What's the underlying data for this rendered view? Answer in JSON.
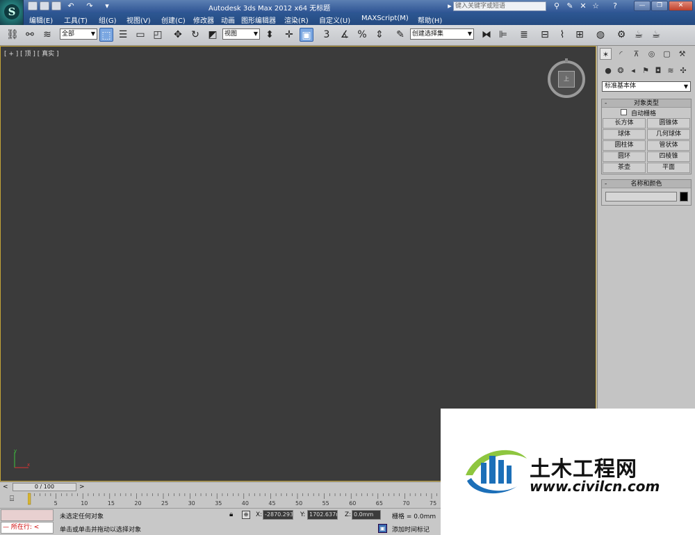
{
  "window": {
    "title": "Autodesk 3ds Max  2012 x64       无标题",
    "search_placeholder": "键入关键字或短语"
  },
  "menu": [
    "编辑(E)",
    "工具(T)",
    "组(G)",
    "视图(V)",
    "创建(C)",
    "修改器",
    "动画",
    "图形编辑器",
    "渲染(R)",
    "自定义(U)",
    "MAXScript(M)",
    "帮助(H)"
  ],
  "toolbar": {
    "selection_filter": "全部",
    "ref_coord": "视图",
    "named_selection": "创建选择集",
    "snap_3": "3",
    "percent_snap": "%"
  },
  "viewport": {
    "label": "[ + ] [ 顶 ] [ 真实 ]",
    "viewcube_face": "上",
    "axis_x": "x",
    "axis_y": "y"
  },
  "command_panel": {
    "category": "标准基本体",
    "object_type": {
      "title": "对象类型",
      "autogrid_label": "自动栅格",
      "autogrid_checked": false,
      "buttons": [
        "长方体",
        "圆锥体",
        "球体",
        "几何球体",
        "圆柱体",
        "管状体",
        "圆环",
        "四棱锥",
        "茶壶",
        "平面"
      ]
    },
    "name_color": {
      "title": "名称和颜色",
      "name_value": "",
      "color": "#000000"
    },
    "rollout_minus": "-"
  },
  "time_slider": {
    "frame_label": "0 / 100",
    "prev": "<",
    "next": ">"
  },
  "track_bar": {
    "ticks": [
      "5",
      "10",
      "15",
      "20",
      "25",
      "30",
      "35",
      "40",
      "45",
      "50",
      "55",
      "60",
      "65",
      "70",
      "75"
    ]
  },
  "status": {
    "running_label": "所在行:",
    "selection": "未选定任何对象",
    "prompt": "单击或单击并拖动以选择对象",
    "x_label": "X:",
    "x_value": "-2870.293",
    "y_label": "Y:",
    "y_value": "1702.637m",
    "z_label": "Z:",
    "z_value": "0.0mm",
    "grid": "栅格 = 0.0mm",
    "add_time_tag": "添加时间标记"
  },
  "watermark": {
    "title": "土木工程网",
    "url": "www.civilcn.com"
  }
}
